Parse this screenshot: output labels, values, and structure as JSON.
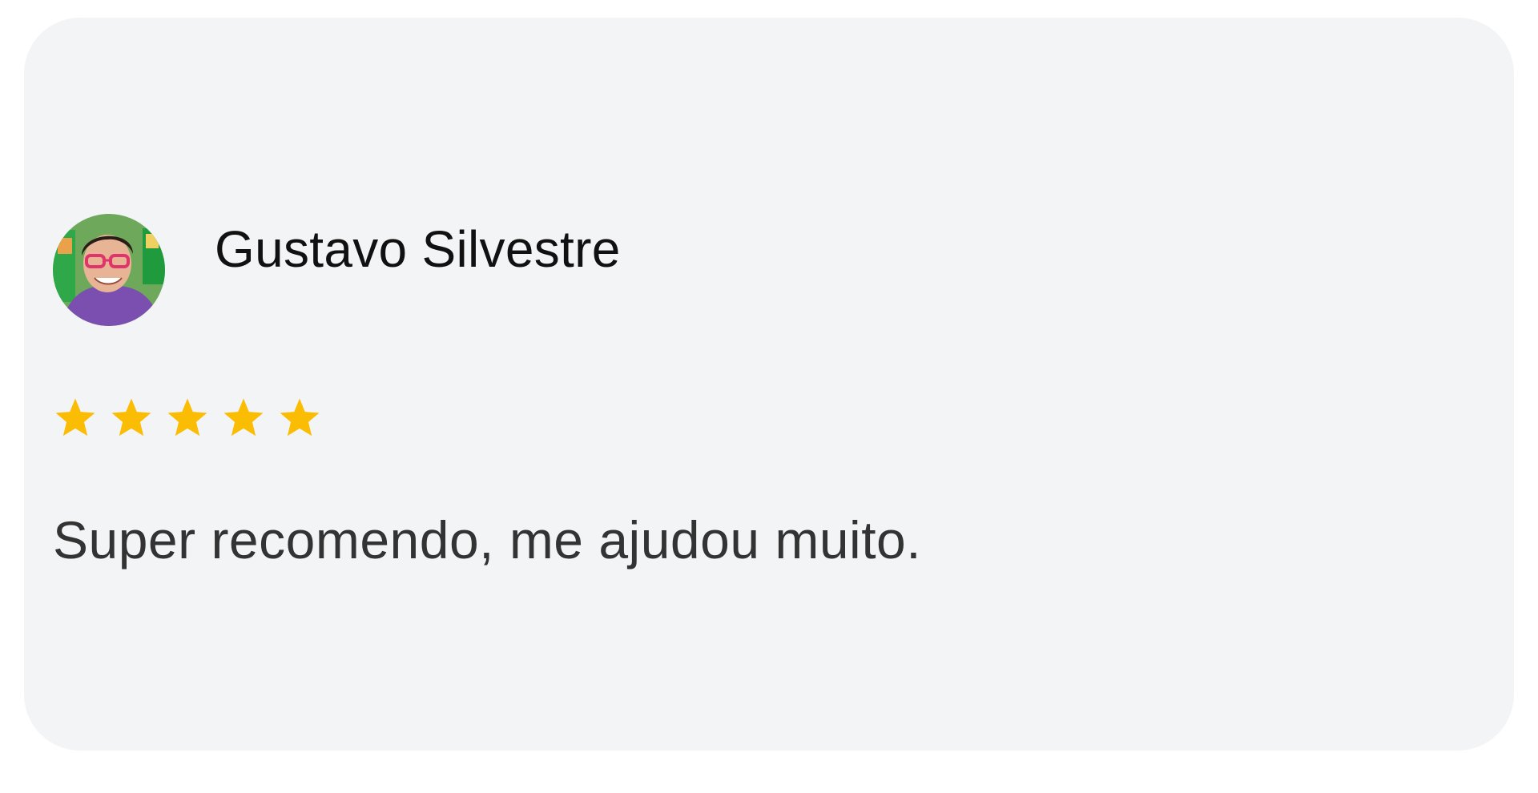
{
  "review": {
    "author_name": "Gustavo Silvestre",
    "rating": 5,
    "rating_max": 5,
    "text": "Super recomendo, me ajudou muito.",
    "avatar_icon": "user-photo-avatar"
  },
  "colors": {
    "card_background": "#f3f4f6",
    "star": "#fbbc04",
    "author_text": "#111111",
    "body_text": "#333333"
  }
}
